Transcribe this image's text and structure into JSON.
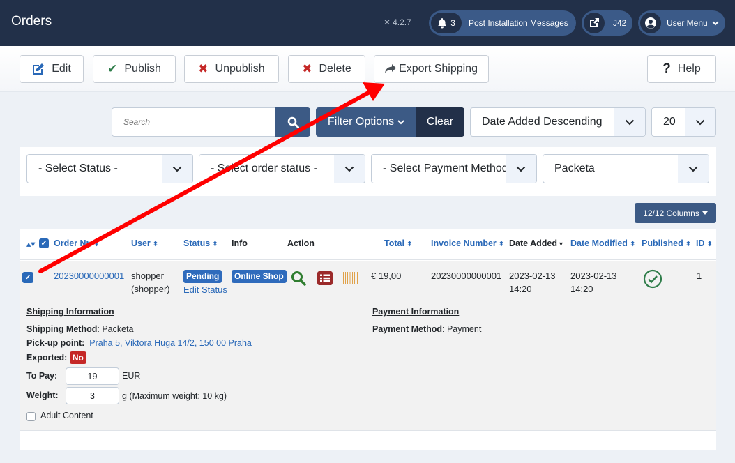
{
  "header": {
    "title": "Orders",
    "version": "4.2.7",
    "notifications_count": "3",
    "notifications_label": "Post Installation Messages",
    "site_label": "J42",
    "user_menu_label": "User Menu"
  },
  "toolbar": {
    "edit": "Edit",
    "publish": "Publish",
    "unpublish": "Unpublish",
    "delete": "Delete",
    "export_shipping": "Export Shipping",
    "help": "Help"
  },
  "search": {
    "placeholder": "Search",
    "filter_options": "Filter Options",
    "clear": "Clear"
  },
  "ordering": {
    "selected": "Date Added Descending"
  },
  "limit": {
    "selected": "20"
  },
  "filters": {
    "status": "- Select Status -",
    "order_status": "- Select order status -",
    "payment_method": "- Select Payment Method -",
    "shipping_method": "Packeta"
  },
  "columns_button": "12/12 Columns",
  "table": {
    "headers": {
      "order_nr": "Order Nr.",
      "user": "User",
      "status": "Status",
      "info": "Info",
      "action": "Action",
      "total": "Total",
      "invoice_number": "Invoice Number",
      "date_added": "Date Added",
      "date_modified": "Date Modified",
      "published": "Published",
      "id": "ID"
    },
    "rows": [
      {
        "checked": true,
        "order_nr": "20230000000001",
        "user_line1": "shopper",
        "user_line2": "(shopper)",
        "status": "Pending",
        "edit_status": "Edit Status",
        "info": "Online Shop",
        "total": "€ 19,00",
        "invoice_number": "20230000000001",
        "date_added_date": "2023-02-13",
        "date_added_time": "14:20",
        "date_modified_date": "2023-02-13",
        "date_modified_time": "14:20",
        "published": true,
        "id": "1",
        "shipping": {
          "title": "Shipping Information",
          "method_label": "Shipping Method",
          "method_value": "Packeta",
          "pickup_label": "Pick-up point:",
          "pickup_value": "Praha 5, Viktora Huga 14/2, 150 00 Praha",
          "exported_label": "Exported:",
          "exported_value": "No",
          "to_pay_label": "To Pay:",
          "to_pay_value": "19",
          "to_pay_unit": "EUR",
          "weight_label": "Weight:",
          "weight_value": "3",
          "weight_unit": "g (Maximum weight: 10 kg)",
          "adult_content_label": "Adult Content",
          "adult_content_checked": false
        },
        "payment": {
          "title": "Payment Information",
          "method_label": "Payment Method",
          "method_value": "Payment"
        }
      }
    ]
  },
  "colors": {
    "header_bg": "#223049",
    "primary": "#3c5a85",
    "link": "#2a69b8",
    "danger": "#c52827",
    "success": "#2f7d4a",
    "annotation_arrow": "#ff0000"
  }
}
